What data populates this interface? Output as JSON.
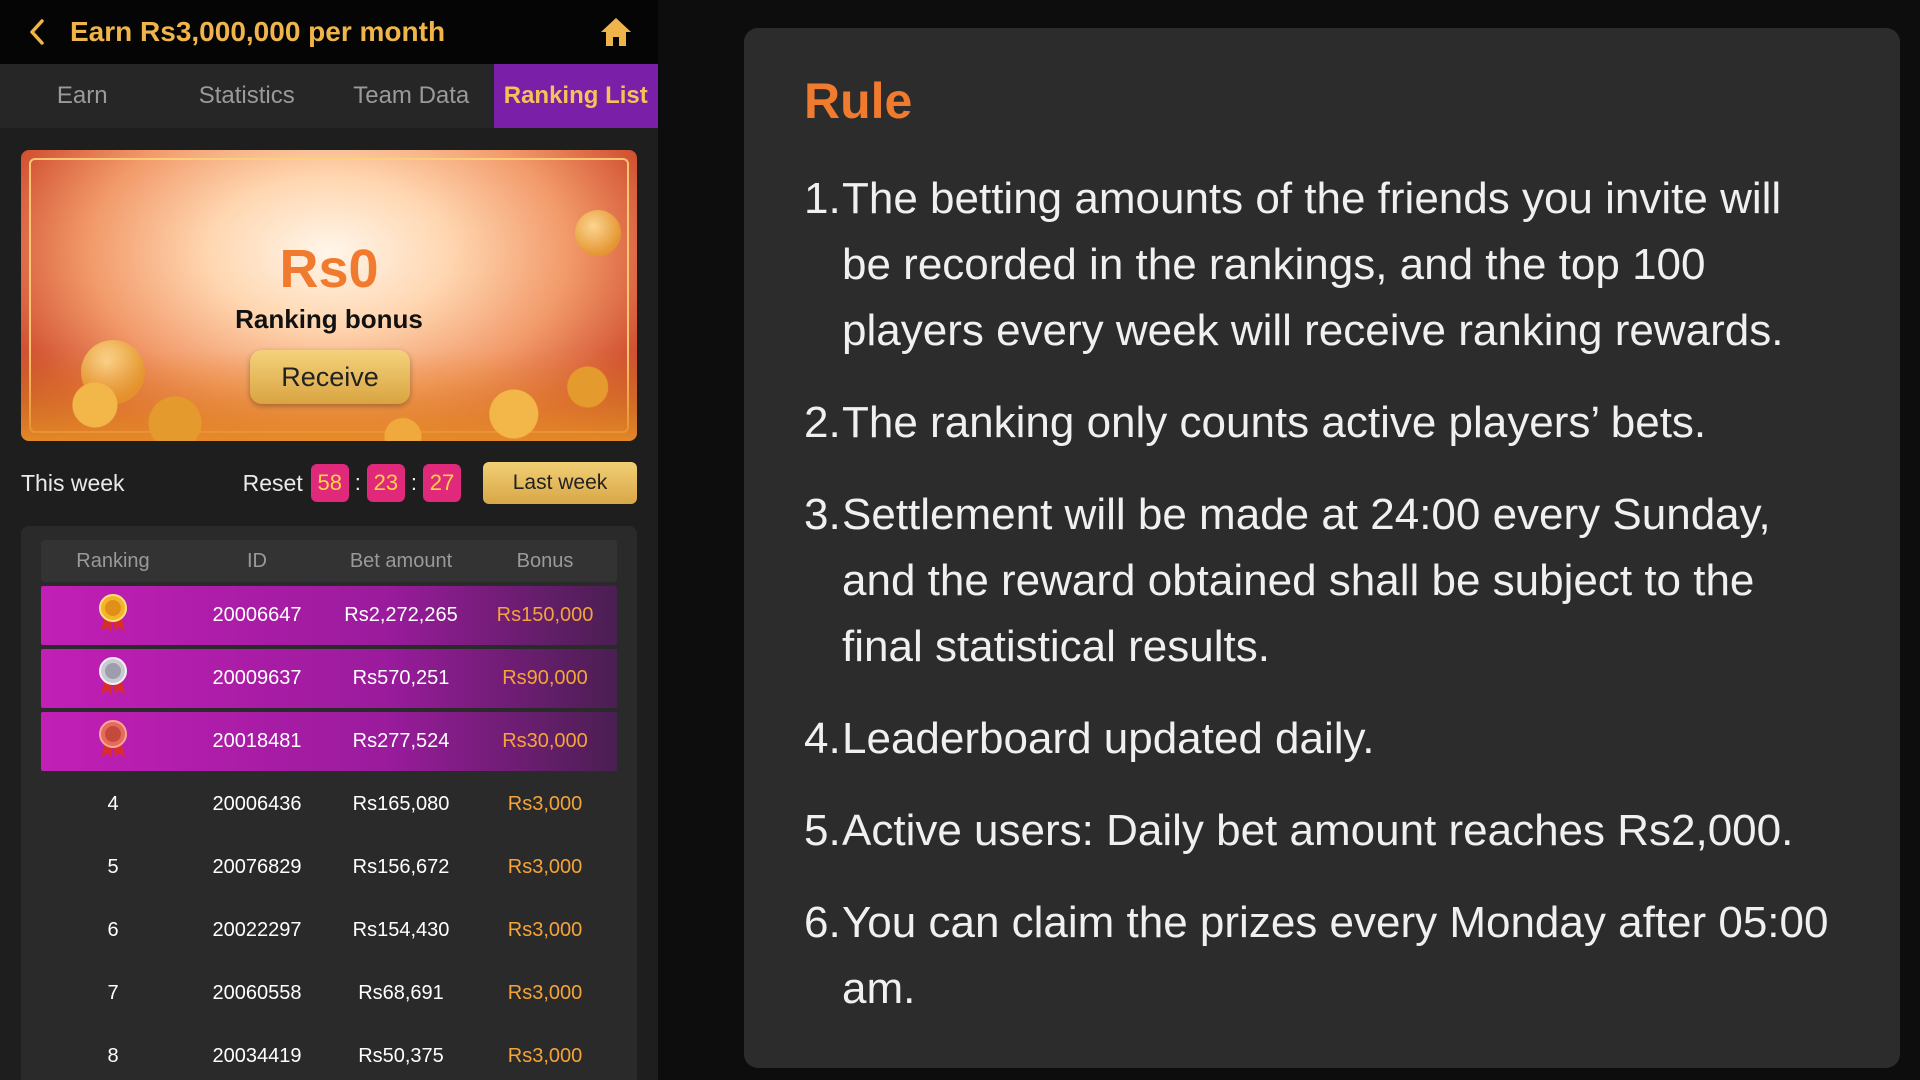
{
  "header": {
    "title": "Earn Rs3,000,000 per month",
    "back_icon": "chevron-left-icon",
    "home_icon": "home-icon"
  },
  "tabs": [
    {
      "label": "Earn",
      "active": false
    },
    {
      "label": "Statistics",
      "active": false
    },
    {
      "label": "Team Data",
      "active": false
    },
    {
      "label": "Ranking List",
      "active": true
    }
  ],
  "banner": {
    "amount": "Rs0",
    "label": "Ranking bonus",
    "receive_label": "Receive"
  },
  "week": {
    "this_week_label": "This week",
    "reset_label": "Reset",
    "timer": [
      "58",
      "23",
      "27"
    ],
    "last_week_label": "Last week"
  },
  "table": {
    "headers": [
      "Ranking",
      "ID",
      "Bet amount",
      "Bonus"
    ],
    "rows": [
      {
        "rank": "1",
        "medal": "gold-medal-icon",
        "id": "20006647",
        "bet": "Rs2,272,265",
        "bonus": "Rs150,000"
      },
      {
        "rank": "2",
        "medal": "silver-medal-icon",
        "id": "20009637",
        "bet": "Rs570,251",
        "bonus": "Rs90,000"
      },
      {
        "rank": "3",
        "medal": "bronze-medal-icon",
        "id": "20018481",
        "bet": "Rs277,524",
        "bonus": "Rs30,000"
      },
      {
        "rank": "4",
        "medal": "",
        "id": "20006436",
        "bet": "Rs165,080",
        "bonus": "Rs3,000"
      },
      {
        "rank": "5",
        "medal": "",
        "id": "20076829",
        "bet": "Rs156,672",
        "bonus": "Rs3,000"
      },
      {
        "rank": "6",
        "medal": "",
        "id": "20022297",
        "bet": "Rs154,430",
        "bonus": "Rs3,000"
      },
      {
        "rank": "7",
        "medal": "",
        "id": "20060558",
        "bet": "Rs68,691",
        "bonus": "Rs3,000"
      },
      {
        "rank": "8",
        "medal": "",
        "id": "20034419",
        "bet": "Rs50,375",
        "bonus": "Rs3,000"
      }
    ]
  },
  "rules": {
    "title": "Rule",
    "items": [
      {
        "num": "1.",
        "text": "The betting amounts of the friends you invite will be recorded in the rankings, and the top 100 players every week will receive ranking rewards."
      },
      {
        "num": "2.",
        "text": "The ranking only counts active players’ bets."
      },
      {
        "num": "3.",
        "text": "Settlement will be made at 24:00 every Sunday, and the reward obtained shall be subject to the final statistical results."
      },
      {
        "num": "4.",
        "text": "Leaderboard updated daily."
      },
      {
        "num": "5.",
        "text": "Active users: Daily bet amount reaches Rs2,000."
      },
      {
        "num": "6.",
        "text": "You can claim the prizes every Monday after 05:00 am."
      }
    ]
  },
  "colors": {
    "accent_gold": "#f0b54a",
    "accent_purple": "#7a1fa8",
    "accent_orange": "#f07b2e",
    "timer_pink": "#e0297a"
  }
}
